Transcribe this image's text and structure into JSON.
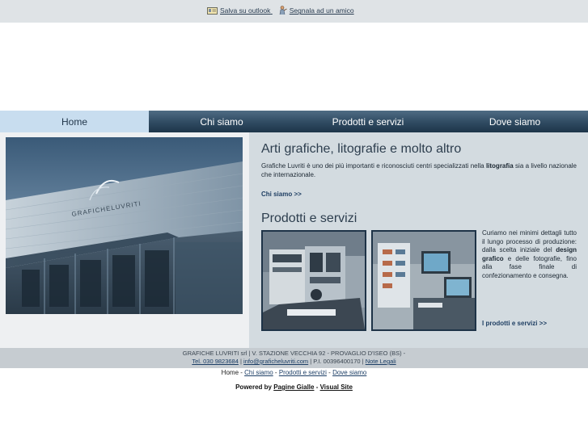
{
  "toplinks": {
    "outlook": "Salva su outlook",
    "friend": "Segnala ad un amico"
  },
  "nav": {
    "home": "Home",
    "about": "Chi siamo",
    "products": "Prodotti e servizi",
    "where": "Dove siamo"
  },
  "hero": {
    "sign": "GRAFICHELUVRITI"
  },
  "section1": {
    "title": "Arti grafiche, litografie e molto altro",
    "text_a": "Grafiche Luvriti è uno dei più importanti e riconosciuti centri specializzati nella ",
    "text_bold": "litografia",
    "text_b": " sia a livello nazionale che internazionale.",
    "link": "Chi siamo >>"
  },
  "section2": {
    "title": "Prodotti e servizi",
    "text_a": "Curiamo nei minimi dettagli tutto il lungo processo di produzione: dalla scelta iniziale del ",
    "text_bold": "design grafico",
    "text_b": " e delle fotografie, fino alla fase finale di confezionamento e consegna.",
    "link": "I prodotti e servizi >>"
  },
  "footer": {
    "address": "GRAFICHE LUVRITI srl | V. STAZIONE VECCHIA 92 - PROVAGLIO D'ISEO (BS) -",
    "phone": "Tel. 030 9823684",
    "sep1": " | ",
    "email": "info@graficheluvriti.com",
    "vat": " | P.I. 00396400170 | ",
    "legal": "Note Legali"
  },
  "bottomnav": {
    "home": "Home",
    "about": "Chi siamo",
    "products": "Prodotti e servizi",
    "where": "Dove siamo",
    "sep": " - "
  },
  "powered": {
    "label": "Powered by ",
    "pg": "Pagine Gialle",
    "dash": " - ",
    "vs": "Visual Site"
  },
  "colors": {
    "nav_dark": "#2f4a61",
    "nav_active": "#c8ddef",
    "panel": "#d3dbe0",
    "link": "#1f3f63"
  }
}
